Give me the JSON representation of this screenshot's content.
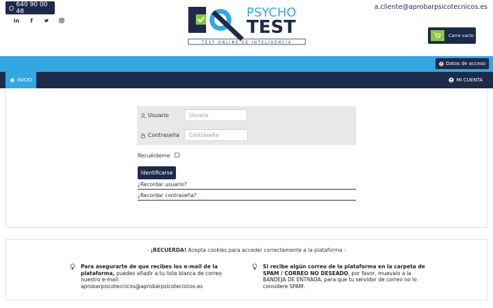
{
  "header": {
    "phone": "640 90 00 48",
    "email": "a.cliente@aprobarpsicotecnicos.es",
    "cart_label": "Carro vacío",
    "socials": [
      "linkedin-icon",
      "facebook-icon",
      "twitter-icon",
      "instagram-icon"
    ],
    "social_glyphs": [
      "in",
      "f"
    ]
  },
  "logo": {
    "word1": "PSYCHO",
    "word2": "TEST",
    "tagline": "TEST ONLINE DE INTELIGENCIA"
  },
  "topbar": {
    "access_label": "Datos de acceso"
  },
  "nav": {
    "home_label": "INICIO",
    "account_label": "MI CUENTA"
  },
  "login": {
    "username_label": "Usuario",
    "username_placeholder": "Usuario",
    "password_label": "Contraseña",
    "password_placeholder": "Contraseña",
    "remember_label": "Recuérdeme",
    "submit_label": "Identificarse",
    "forgot_user": "¿Recordar usuario?",
    "forgot_password": "¿Recordar contraseña?"
  },
  "info": {
    "notice_prefix": "- ",
    "notice_strong": "¡RECUERDA!",
    "notice_rest": " Acepta cookies para acceder correctamente a la plataforma -",
    "tip1_strong": "Para asegurarte de que recibes los e-mail de la plataforma,",
    "tip1_rest": " puedes añadir a tu lista blanca de correo nuestro e-mail: aprobarpsicotecnicos@aprobarpsicotecnicos.es",
    "tip2_strong": "Si recibe algún correo de la plataforma en la carpeta de SPAM / CORREO NO DESEADO",
    "tip2_rest": ", por favor, muevalo a la BANDEJA DE ENTRADA, para que tu servidor de correo no lo considere SPAM."
  },
  "colors": {
    "navy": "#1e2a4a",
    "blue": "#33a8e0",
    "green": "#8cc63f"
  }
}
